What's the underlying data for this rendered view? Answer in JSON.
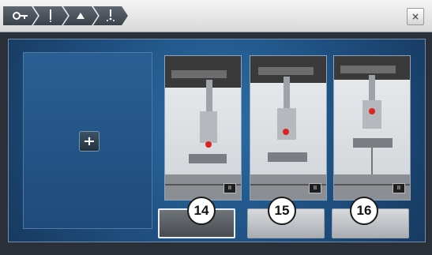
{
  "breadcrumb": [
    {
      "icon": "key-icon"
    },
    {
      "icon": "needle-icon"
    },
    {
      "icon": "presser-foot-icon"
    },
    {
      "icon": "needle-stop-icon"
    }
  ],
  "close_label": "×",
  "options": [
    {
      "number": "14",
      "selected": true
    },
    {
      "number": "15",
      "selected": false
    },
    {
      "number": "16",
      "selected": false
    }
  ],
  "photo_badge": "II"
}
